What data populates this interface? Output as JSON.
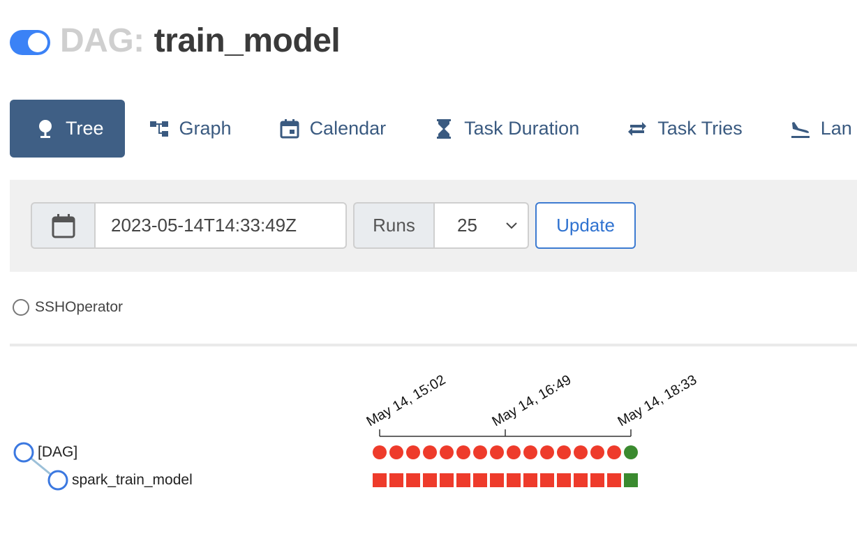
{
  "header": {
    "dag_prefix": "DAG:",
    "dag_name": "train_model",
    "paused_toggle_on": true
  },
  "tabs": [
    {
      "label": "Tree",
      "icon": "tree-icon",
      "active": true
    },
    {
      "label": "Graph",
      "icon": "graph-icon",
      "active": false
    },
    {
      "label": "Calendar",
      "icon": "calendar-icon",
      "active": false
    },
    {
      "label": "Task Duration",
      "icon": "hourglass-icon",
      "active": false
    },
    {
      "label": "Task Tries",
      "icon": "repeat-icon",
      "active": false
    },
    {
      "label": "Lan",
      "icon": "landing-icon",
      "active": false
    }
  ],
  "filters": {
    "date_value": "2023-05-14T14:33:49Z",
    "runs_label": "Runs",
    "runs_value": "25",
    "update_label": "Update"
  },
  "legend": {
    "operator": "SSHOperator"
  },
  "tree": {
    "dag_label": "[DAG]",
    "task_label": "spark_train_model",
    "date_ticks": [
      "May 14, 15:02",
      "May 14, 16:49",
      "May 14, 18:33"
    ],
    "run_states": [
      "failed",
      "failed",
      "failed",
      "failed",
      "failed",
      "failed",
      "failed",
      "failed",
      "failed",
      "failed",
      "failed",
      "failed",
      "failed",
      "failed",
      "failed",
      "success"
    ],
    "task_states": [
      "failed",
      "failed",
      "failed",
      "failed",
      "failed",
      "failed",
      "failed",
      "failed",
      "failed",
      "failed",
      "failed",
      "failed",
      "failed",
      "failed",
      "failed",
      "success"
    ],
    "colors": {
      "failed": "#ee3b2b",
      "success": "#3a8a2f",
      "node_stroke": "#3b78e0",
      "link": "#9cc0d8"
    }
  },
  "colors": {
    "accent": "#3f5f85",
    "tab_text": "#3a5a80",
    "toggle": "#3b82f6",
    "update": "#2f72d0"
  }
}
